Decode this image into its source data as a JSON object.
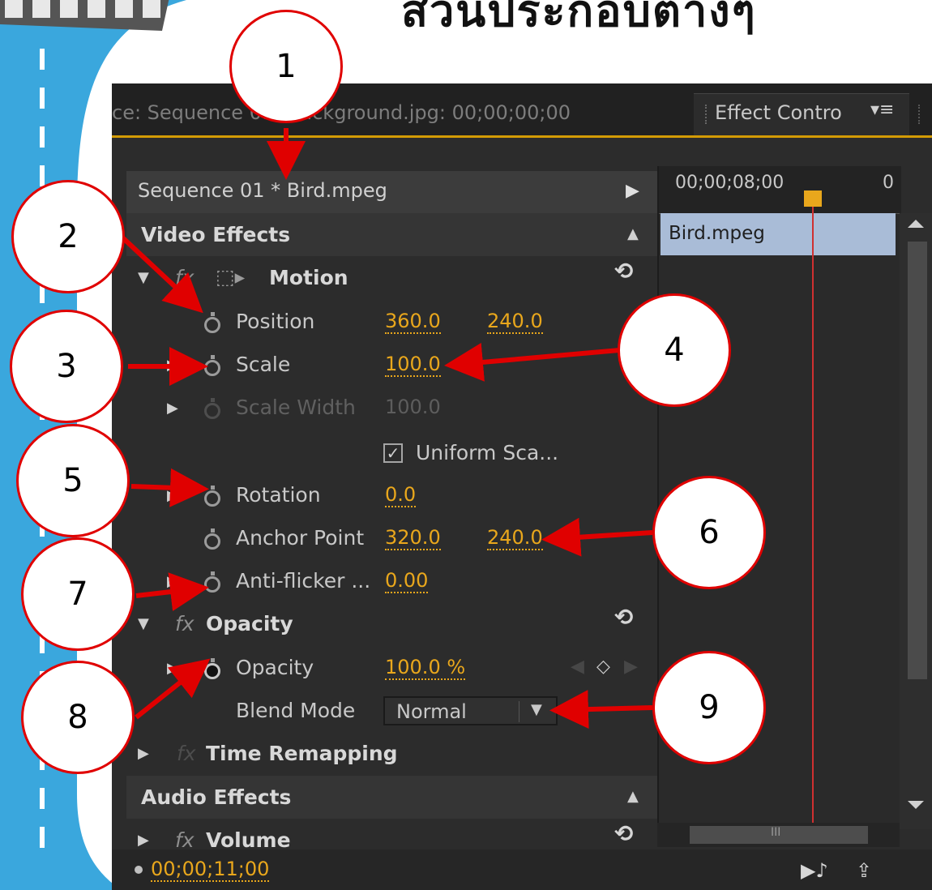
{
  "page": {
    "title": "ส่วนประกอบต่างๆ"
  },
  "tabs": {
    "sequence_tab": "ce: Sequence 01: Background.jpg: 00;00;00;00",
    "active_tab": "Effect Contro",
    "menu_icon": "panel-menu-icon"
  },
  "clip_header": {
    "label": "Sequence 01 * Bird.mpeg"
  },
  "timeline": {
    "timecode": "00;00;08;00",
    "end_marker": "0",
    "clip_name": "Bird.mpeg"
  },
  "effects": {
    "video_section": "Video Effects",
    "motion": "Motion",
    "position_label": "Position",
    "position_x": "360.0",
    "position_y": "240.0",
    "scale_label": "Scale",
    "scale_value": "100.0",
    "scale_width_label": "Scale Width",
    "scale_width_value": "100.0",
    "uniform_scale_label": "Uniform Sca...",
    "uniform_scale_checked": true,
    "rotation_label": "Rotation",
    "rotation_value": "0.0",
    "anchor_label": "Anchor Point",
    "anchor_x": "320.0",
    "anchor_y": "240.0",
    "antiflicker_label": "Anti-flicker ...",
    "antiflicker_value": "0.00",
    "opacity_section": "Opacity",
    "opacity_label": "Opacity",
    "opacity_value": "100.0 %",
    "blend_label": "Blend Mode",
    "blend_value": "Normal",
    "time_remap": "Time Remapping",
    "audio_section": "Audio Effects",
    "volume": "Volume"
  },
  "footer": {
    "timecode": "00;00;11;00"
  },
  "callouts": [
    "1",
    "2",
    "3",
    "4",
    "5",
    "6",
    "7",
    "8",
    "9"
  ],
  "colors": {
    "accent": "#e9a71c",
    "callout_border": "#e00000",
    "panel_bg": "#2c2c2c",
    "background_wave": "#3aa7dd"
  }
}
